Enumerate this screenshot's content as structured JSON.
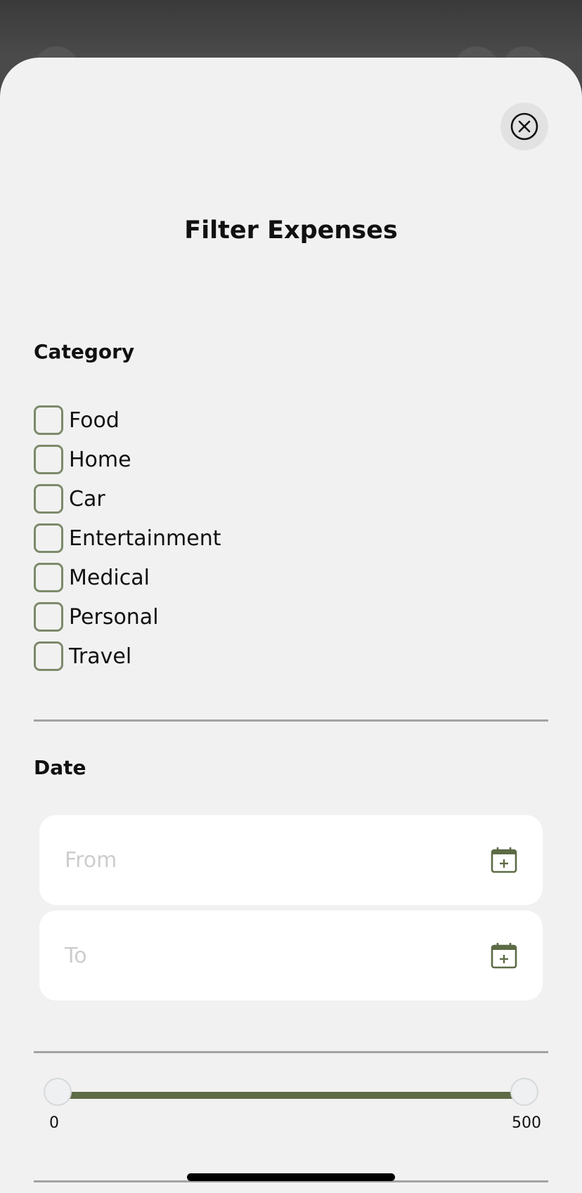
{
  "sheet": {
    "title": "Filter Expenses",
    "close_icon": "close-circle-icon"
  },
  "category": {
    "heading": "Category",
    "items": [
      {
        "label": "Food",
        "checked": false
      },
      {
        "label": "Home",
        "checked": false
      },
      {
        "label": "Car",
        "checked": false
      },
      {
        "label": "Entertainment",
        "checked": false
      },
      {
        "label": "Medical",
        "checked": false
      },
      {
        "label": "Personal",
        "checked": false
      },
      {
        "label": "Travel",
        "checked": false
      }
    ]
  },
  "date": {
    "heading": "Date",
    "from": {
      "placeholder": "From",
      "value": "",
      "icon": "calendar-add-icon"
    },
    "to": {
      "placeholder": "To",
      "value": "",
      "icon": "calendar-add-icon"
    }
  },
  "amount_range": {
    "min_label": "0",
    "max_label": "500",
    "min": 0,
    "max": 500,
    "selected_low": 0,
    "selected_high": 500
  },
  "colors": {
    "accent": "#5d6b46",
    "checkbox_border": "#7c8a6a",
    "sheet_background": "#f1f1f1"
  }
}
